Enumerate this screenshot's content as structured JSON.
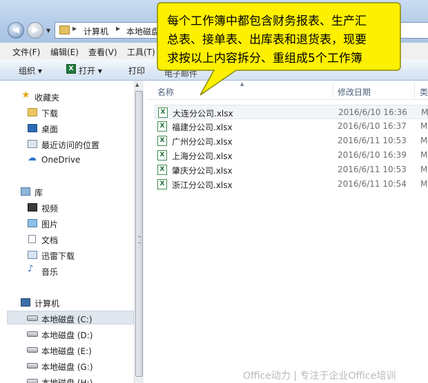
{
  "address": {
    "crumbs": [
      "计算机",
      "本地磁盘"
    ]
  },
  "menu": [
    "文件(F)",
    "编辑(E)",
    "查看(V)",
    "工具(T)"
  ],
  "toolbar": {
    "organize": "组织 ▾",
    "open": "打开 ▾",
    "print": "打印",
    "hidden_partial": "电子邮件"
  },
  "nav": {
    "favorites": "收藏夹",
    "fav_items": [
      "下载",
      "桌面",
      "最近访问的位置",
      "OneDrive"
    ],
    "library": "库",
    "lib_items": [
      "视频",
      "图片",
      "文档",
      "迅雷下载",
      "音乐"
    ],
    "computer": "计算机",
    "drives": [
      "本地磁盘 (C:)",
      "本地磁盘 (D:)",
      "本地磁盘 (E:)",
      "本地磁盘 (G:)",
      "本地磁盘 (H:)"
    ]
  },
  "columns": {
    "name": "名称",
    "modified": "修改日期",
    "type": "类"
  },
  "files": [
    {
      "name": "大连分公司.xlsx",
      "date": "2016/6/10 16:36",
      "type": "M"
    },
    {
      "name": "福建分公司.xlsx",
      "date": "2016/6/10 16:37",
      "type": "M"
    },
    {
      "name": "广州分公司.xlsx",
      "date": "2016/6/11 10:53",
      "type": "M"
    },
    {
      "name": "上海分公司.xlsx",
      "date": "2016/6/10 16:39",
      "type": "M"
    },
    {
      "name": "肇庆分公司.xlsx",
      "date": "2016/6/11 10:53",
      "type": "M"
    },
    {
      "name": "浙江分公司.xlsx",
      "date": "2016/6/11 10:54",
      "type": "M"
    }
  ],
  "callout": {
    "lines": [
      "每个工作簿中都包含财务报表、生产汇",
      "总表、接单表、出库表和退货表，现要",
      "求按以上内容拆分、重组成5个工作簿"
    ],
    "fill": "#fdf000",
    "border": "#8a8a00"
  },
  "watermark": "Office动力 | 专注于企业Office培训"
}
